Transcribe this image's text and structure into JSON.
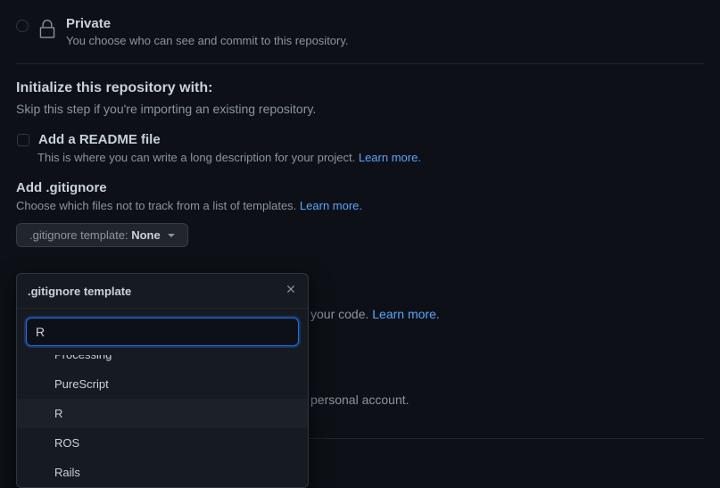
{
  "visibility": {
    "private_title": "Private",
    "private_desc": "You choose who can see and commit to this repository."
  },
  "init": {
    "heading": "Initialize this repository with:",
    "sub": "Skip this step if you're importing an existing repository."
  },
  "readme": {
    "title": "Add a README file",
    "desc": "This is where you can write a long description for your project. ",
    "learn": "Learn more."
  },
  "gitignore": {
    "title": "Add .gitignore",
    "desc": "Choose which files not to track from a list of templates. ",
    "learn": "Learn more.",
    "btn_label": ".gitignore template: ",
    "btn_value": "None"
  },
  "popover": {
    "title": ".gitignore template",
    "search_value": "R",
    "items": [
      "Processing",
      "PureScript",
      "R",
      "ROS",
      "Rails"
    ]
  },
  "license": {
    "hint_suffix": " your code. ",
    "learn": "Learn more."
  },
  "personal": {
    "hint_suffix": " personal account."
  }
}
